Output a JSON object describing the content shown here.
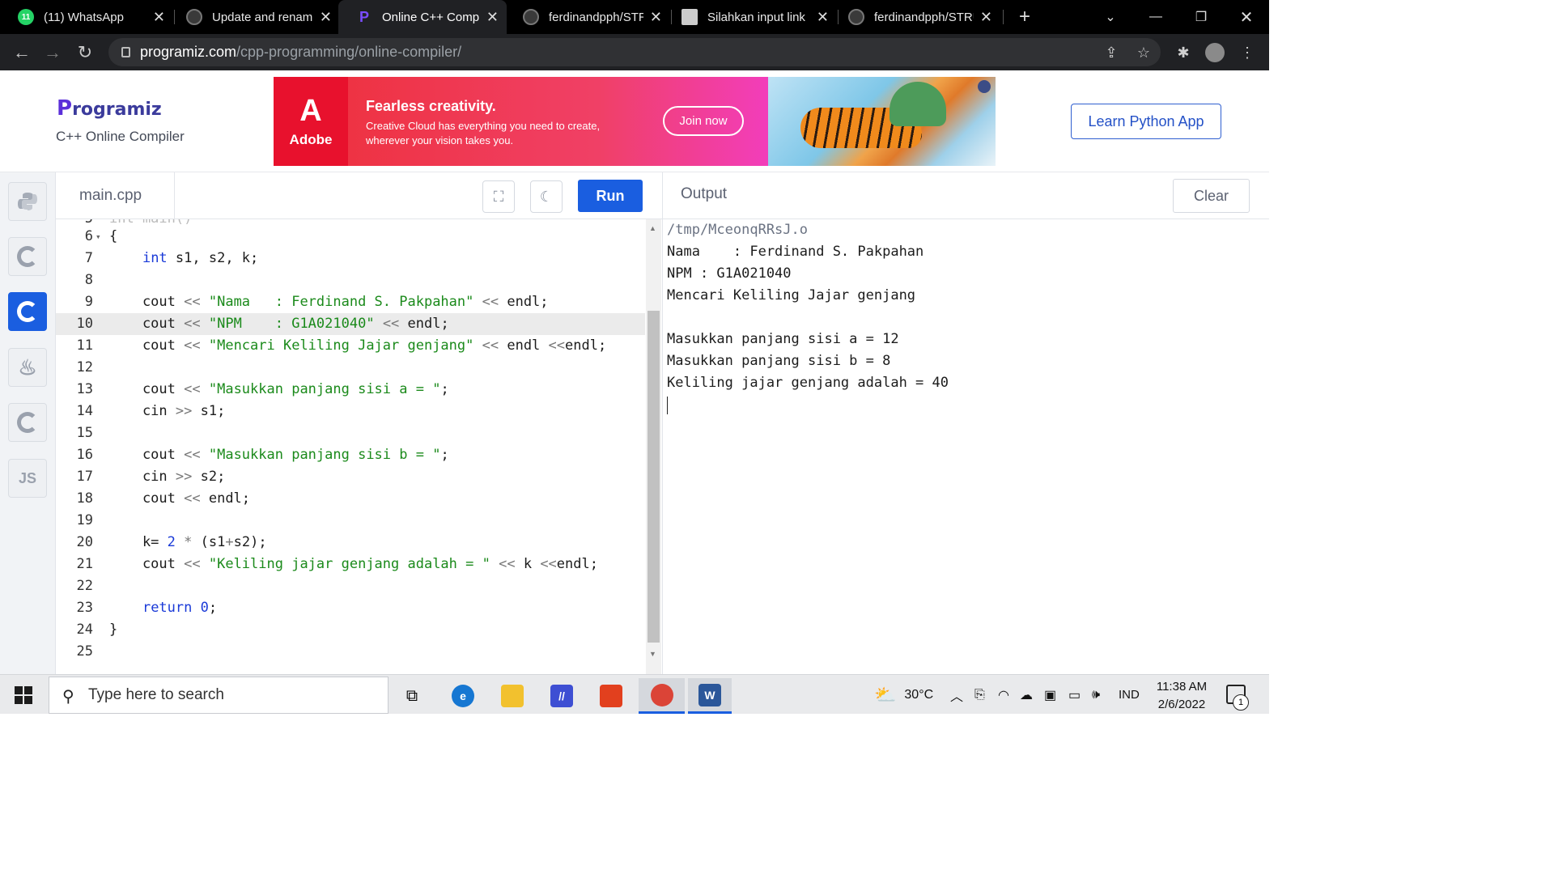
{
  "browser": {
    "tabs": [
      {
        "title": "(11) WhatsApp",
        "icon": "whatsapp-icon",
        "badge": "11"
      },
      {
        "title": "Update and renam",
        "icon": "github-icon"
      },
      {
        "title": "Online C++ Compil",
        "icon": "programiz-icon",
        "active": true
      },
      {
        "title": "ferdinandpph/STRU",
        "icon": "github-icon"
      },
      {
        "title": "Silahkan input link",
        "icon": "classroom-icon"
      },
      {
        "title": "ferdinandpph/STRU",
        "icon": "github-icon"
      }
    ],
    "url_host": "programiz.com",
    "url_path": "/cpp-programming/online-compiler/"
  },
  "site": {
    "logo_text": "rogramiz",
    "logo_letter": "P",
    "subtitle": "C++ Online Compiler",
    "learn_button": "Learn Python App"
  },
  "ad": {
    "brand": "Adobe",
    "headline": "Fearless creativity.",
    "body": "Creative Cloud has everything you need to create, wherever your vision takes you.",
    "cta": "Join now"
  },
  "languages": [
    {
      "name": "python",
      "icon": "python-icon"
    },
    {
      "name": "c",
      "icon": "c-icon"
    },
    {
      "name": "cpp",
      "icon": "cpp-icon",
      "active": true
    },
    {
      "name": "java",
      "icon": "java-icon"
    },
    {
      "name": "csharp",
      "icon": "csharp-icon"
    },
    {
      "name": "js",
      "label": "JS",
      "icon": "js-icon"
    }
  ],
  "editor": {
    "file_name": "main.cpp",
    "run_label": "Run",
    "highlighted_line": 10,
    "lines": [
      {
        "n": "6",
        "fold": "▾",
        "parts": [
          [
            "",
            "{"
          ]
        ]
      },
      {
        "n": "7",
        "parts": [
          [
            "",
            "    "
          ],
          [
            "kw",
            "int"
          ],
          [
            "",
            " s1, s2, k;"
          ]
        ]
      },
      {
        "n": "8",
        "parts": []
      },
      {
        "n": "9",
        "parts": [
          [
            "",
            "    cout "
          ],
          [
            "op",
            "<<"
          ],
          [
            "",
            " "
          ],
          [
            "str",
            "\"Nama   : Ferdinand S. Pakpahan\""
          ],
          [
            "",
            " "
          ],
          [
            "op",
            "<<"
          ],
          [
            "",
            " endl;"
          ]
        ]
      },
      {
        "n": "10",
        "parts": [
          [
            "",
            "    cout "
          ],
          [
            "op",
            "<<"
          ],
          [
            "",
            " "
          ],
          [
            "str",
            "\"NPM    : G1A021040\""
          ],
          [
            "",
            " "
          ],
          [
            "op",
            "<<"
          ],
          [
            "",
            " endl;"
          ]
        ]
      },
      {
        "n": "11",
        "parts": [
          [
            "",
            "    cout "
          ],
          [
            "op",
            "<<"
          ],
          [
            "",
            " "
          ],
          [
            "str",
            "\"Mencari Keliling Jajar genjang\""
          ],
          [
            "",
            " "
          ],
          [
            "op",
            "<<"
          ],
          [
            "",
            " endl "
          ],
          [
            "op",
            "<<"
          ],
          [
            "",
            "endl;"
          ]
        ]
      },
      {
        "n": "12",
        "parts": []
      },
      {
        "n": "13",
        "parts": [
          [
            "",
            "    cout "
          ],
          [
            "op",
            "<<"
          ],
          [
            "",
            " "
          ],
          [
            "str",
            "\"Masukkan panjang sisi a = \""
          ],
          [
            "",
            ";"
          ]
        ]
      },
      {
        "n": "14",
        "parts": [
          [
            "",
            "    cin "
          ],
          [
            "op",
            ">>"
          ],
          [
            "",
            " s1;"
          ]
        ]
      },
      {
        "n": "15",
        "parts": []
      },
      {
        "n": "16",
        "parts": [
          [
            "",
            "    cout "
          ],
          [
            "op",
            "<<"
          ],
          [
            "",
            " "
          ],
          [
            "str",
            "\"Masukkan panjang sisi b = \""
          ],
          [
            "",
            ";"
          ]
        ]
      },
      {
        "n": "17",
        "parts": [
          [
            "",
            "    cin "
          ],
          [
            "op",
            ">>"
          ],
          [
            "",
            " s2;"
          ]
        ]
      },
      {
        "n": "18",
        "parts": [
          [
            "",
            "    cout "
          ],
          [
            "op",
            "<<"
          ],
          [
            "",
            " endl;"
          ]
        ]
      },
      {
        "n": "19",
        "parts": []
      },
      {
        "n": "20",
        "parts": [
          [
            "",
            "    k= "
          ],
          [
            "num",
            "2"
          ],
          [
            "",
            " "
          ],
          [
            "op",
            "*"
          ],
          [
            "",
            " (s1"
          ],
          [
            "op",
            "+"
          ],
          [
            "",
            "s2);"
          ]
        ]
      },
      {
        "n": "21",
        "parts": [
          [
            "",
            "    cout "
          ],
          [
            "op",
            "<<"
          ],
          [
            "",
            " "
          ],
          [
            "str",
            "\"Keliling jajar genjang adalah = \""
          ],
          [
            "",
            " "
          ],
          [
            "op",
            "<<"
          ],
          [
            "",
            " k "
          ],
          [
            "op",
            "<<"
          ],
          [
            "",
            "endl;"
          ]
        ]
      },
      {
        "n": "22",
        "parts": []
      },
      {
        "n": "23",
        "parts": [
          [
            "",
            "    "
          ],
          [
            "kw",
            "return"
          ],
          [
            "",
            " "
          ],
          [
            "num",
            "0"
          ],
          [
            "",
            ";"
          ]
        ]
      },
      {
        "n": "24",
        "parts": [
          [
            "",
            "}"
          ]
        ]
      },
      {
        "n": "25",
        "parts": []
      }
    ]
  },
  "output": {
    "title": "Output",
    "clear_label": "Clear",
    "lines": [
      "/tmp/MceonqRRsJ.o",
      "Nama    : Ferdinand S. Pakpahan",
      "NPM : G1A021040",
      "Mencari Keliling Jajar genjang",
      "",
      "Masukkan panjang sisi a = 12",
      "Masukkan panjang sisi b = 8",
      "Keliling jajar genjang adalah = 40"
    ]
  },
  "taskbar": {
    "search_placeholder": "Type here to search",
    "weather": "30°C",
    "language": "IND",
    "time": "11:38 AM",
    "date": "2/6/2022",
    "notification_count": "1"
  },
  "colors": {
    "accent": "#1a5ee0",
    "string": "#1b8a1b",
    "keyword": "#1a3ad8"
  }
}
